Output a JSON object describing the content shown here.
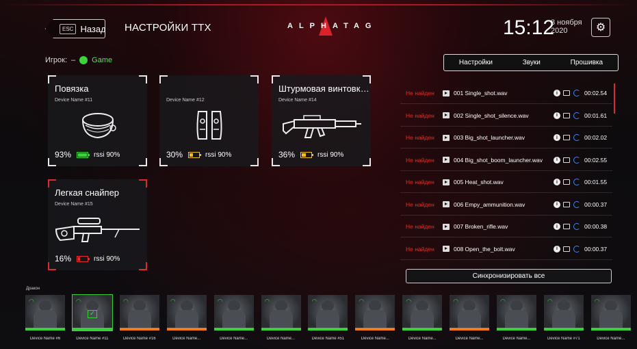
{
  "header": {
    "back_key": "ESC",
    "back_label": "Назад",
    "title": "НАСТРОЙКИ ТТХ",
    "logo": "ALPHATAG",
    "time": "15:12",
    "date_day": "3 ноября",
    "date_year": "2020",
    "settings_icon": "gear-icon"
  },
  "player": {
    "label": "Игрок:",
    "value": "–",
    "mode": "Game",
    "status_color": "#3fd23f"
  },
  "devices": [
    {
      "title": "Повязка",
      "device": "Device Name #11",
      "battery": "93%",
      "battery_level": 0.93,
      "battery_color": "green",
      "rssi": "rssi 90%",
      "icon": "headband-icon"
    },
    {
      "title": "",
      "device": "Device Name #12",
      "battery": "30%",
      "battery_level": 0.3,
      "battery_color": "yellow",
      "rssi": "rssi 90%",
      "icon": "vest-icon"
    },
    {
      "title": "Штурмовая винтовка...",
      "device": "Device Name #14",
      "battery": "36%",
      "battery_level": 0.36,
      "battery_color": "yellow",
      "rssi": "rssi 90%",
      "icon": "assault-rifle-icon"
    },
    {
      "title": "Легкая снайпер",
      "device": "Device Name #15",
      "battery": "16%",
      "battery_level": 0.16,
      "battery_color": "red",
      "rssi": "rssi 90%",
      "icon": "sniper-rifle-icon"
    }
  ],
  "tabs": [
    "Настройки",
    "Звуки",
    "Прошивка"
  ],
  "sounds": [
    {
      "status": "Не найден",
      "file": "001 Single_shot.wav",
      "time": "00:02.54"
    },
    {
      "status": "Не найден",
      "file": "002 Single_shot_silence.wav",
      "time": "00:01.61"
    },
    {
      "status": "Не найден",
      "file": "003 Big_shot_launcher.wav",
      "time": "00:02.02"
    },
    {
      "status": "Не найден",
      "file": "004 Big_shot_boom_launcher.wav",
      "time": "00:02.55"
    },
    {
      "status": "Не найден",
      "file": "005 Heat_shot.wav",
      "time": "00:01.55"
    },
    {
      "status": "Не найден",
      "file": "006 Empy_ammunition.wav",
      "time": "00:00.37"
    },
    {
      "status": "Не найден",
      "file": "007 Broken_rifle.wav",
      "time": "00:00.38"
    },
    {
      "status": "Не найден",
      "file": "008 Open_the_bolt.wav",
      "time": "00:00.37"
    }
  ],
  "sync_all": "Синхронизировать все",
  "team": {
    "label": "Дракон",
    "players": [
      {
        "name": "Device Name #6",
        "bar": "#3ccf3c",
        "selected": false
      },
      {
        "name": "Device Name #11",
        "bar": "#3ccf3c",
        "selected": true
      },
      {
        "name": "Device Name #16",
        "bar": "#f07a20",
        "selected": false
      },
      {
        "name": "Device Name...",
        "bar": "#f07a20",
        "selected": false
      },
      {
        "name": "Device Name...",
        "bar": "#3ccf3c",
        "selected": false
      },
      {
        "name": "Device Name...",
        "bar": "#3ccf3c",
        "selected": false
      },
      {
        "name": "Device Name #51",
        "bar": "#3ccf3c",
        "selected": false
      },
      {
        "name": "Device Name...",
        "bar": "#f07a20",
        "selected": false
      },
      {
        "name": "Device Name...",
        "bar": "#3ccf3c",
        "selected": false
      },
      {
        "name": "Device Name...",
        "bar": "#f07a20",
        "selected": false
      },
      {
        "name": "Device Name...",
        "bar": "#3ccf3c",
        "selected": false
      },
      {
        "name": "Device Name #71",
        "bar": "#3ccf3c",
        "selected": false
      },
      {
        "name": "Device Name...",
        "bar": "#3ccf3c",
        "selected": false
      }
    ]
  },
  "colors": {
    "accent": "#e02a2a",
    "ok": "#3ccf3c",
    "warn": "#f0c020",
    "sync": "#3a8cff"
  }
}
